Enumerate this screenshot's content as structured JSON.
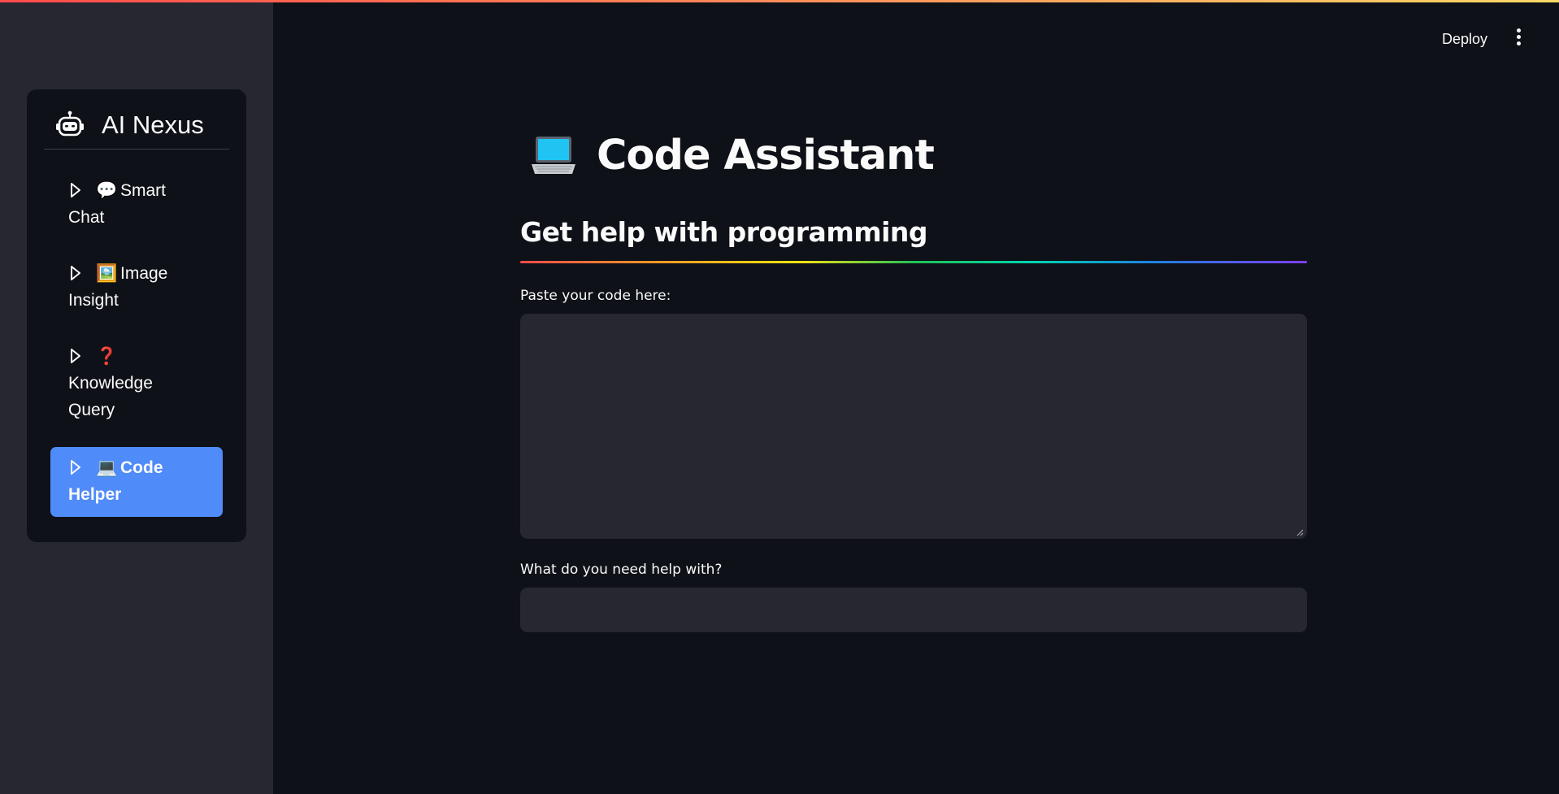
{
  "sidebar": {
    "brand": {
      "title": "AI Nexus",
      "icon": "robot-icon"
    },
    "items": [
      {
        "emoji": "💬",
        "label_line1": "Smart",
        "label_line2": "Chat",
        "icon": "speech-bubble-icon",
        "active": false
      },
      {
        "emoji": "🖼️",
        "label_line1": "Image",
        "label_line2": "Insight",
        "icon": "picture-icon",
        "active": false
      },
      {
        "emoji": "❓",
        "label_line1": "Knowledge",
        "label_line2": "Query",
        "icon": "question-mark-icon",
        "active": false
      },
      {
        "emoji": "💻",
        "label_line1": "Code",
        "label_line2": "Helper",
        "icon": "laptop-icon",
        "active": true
      }
    ]
  },
  "header": {
    "deploy_label": "Deploy",
    "menu_icon": "kebab-menu-icon"
  },
  "main": {
    "title": "Code Assistant",
    "title_icon": "laptop-icon",
    "subheader": "Get help with programming",
    "code_field": {
      "label": "Paste your code here:",
      "value": ""
    },
    "help_field": {
      "label": "What do you need help with?",
      "value": ""
    }
  },
  "colors": {
    "background": "#0e1117",
    "sidebar": "#262730",
    "accent_active": "#4f8bf9",
    "input_bg": "#262730"
  }
}
